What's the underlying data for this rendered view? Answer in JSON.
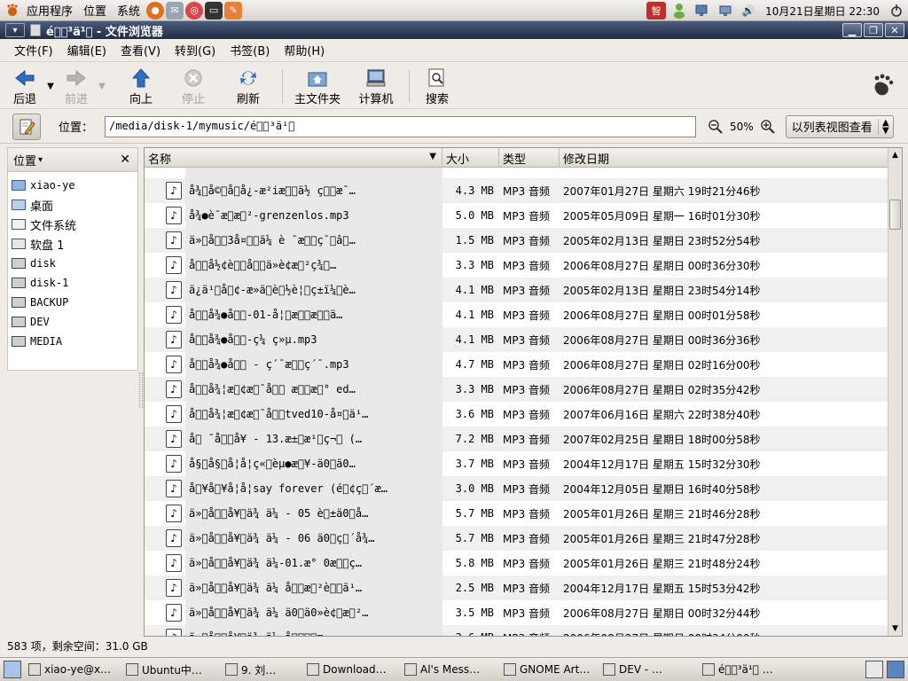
{
  "top_panel": {
    "menus": [
      "应用程序",
      "位置",
      "系统"
    ],
    "clock": "10月21日星期日 22:30"
  },
  "window": {
    "title": "é\u0000\u0000³ä¹\u0000 - 文件浏览器"
  },
  "menubar": [
    "文件(F)",
    "编辑(E)",
    "查看(V)",
    "转到(G)",
    "书签(B)",
    "帮助(H)"
  ],
  "toolbar": {
    "back": "后退",
    "forward": "前进",
    "up": "向上",
    "stop": "停止",
    "reload": "刷新",
    "home": "主文件夹",
    "computer": "计算机",
    "search": "搜索"
  },
  "location": {
    "label": "位置：",
    "path": "/media/disk-1/mymusic/é\u0000\u0000³ä¹\u0000",
    "zoom": "50%",
    "view_mode": "以列表视图查看"
  },
  "sidebar": {
    "header": "位置",
    "items": [
      {
        "label": "xiao-ye",
        "icon": "home-icon"
      },
      {
        "label": "桌面",
        "icon": "desktop-icon"
      },
      {
        "label": "文件系统",
        "icon": "filesystem-icon"
      },
      {
        "label": "软盘 1",
        "icon": "floppy-icon"
      },
      {
        "label": "disk",
        "icon": "drive-icon"
      },
      {
        "label": "disk-1",
        "icon": "drive-icon"
      },
      {
        "label": "BACKUP",
        "icon": "drive-icon"
      },
      {
        "label": "DEV",
        "icon": "drive-icon"
      },
      {
        "label": "MEDIA",
        "icon": "drive-icon"
      }
    ]
  },
  "columns": {
    "name": "名称",
    "size": "大小",
    "type": "类型",
    "date": "修改日期"
  },
  "files": [
    {
      "name": "å¾\u0000å©\u0000å\u0000å¿-æ²iæ\u0000\u0000ä½ ç\u0000\u0000æ¯…",
      "size": "4.3 MB",
      "type": "MP3 音频",
      "date": "2007年01月27日 星期六 19时21分46秒"
    },
    {
      "name": "å¾●è¯æ\u0000æ\u0000²-grenzenlos.mp3",
      "size": "5.0 MB",
      "type": "MP3 音频",
      "date": "2005年05月09日 星期一 16时01分30秒"
    },
    {
      "name": "ä»\u0000å\u0000\u00003å¤\u0000\u0000ä¼ è ¯æ\u0000\u0000ç¯\u0000â\u0000…",
      "size": "1.5 MB",
      "type": "MP3 音频",
      "date": "2005年02月13日 星期日 23时52分54秒"
    },
    {
      "name": "å\u0000\u0000å½¢è\u0000\u0000å\u0000\u0000ä»è¢æ\u0000²ç¾\u0000…",
      "size": "3.3 MB",
      "type": "MP3 音频",
      "date": "2006年08月27日 星期日 00时36分30秒"
    },
    {
      "name": "ä¿ä¹\u0000å\u0000¢-æ»ä\u0000è\u0000½è¦\u0000ç±ï¼\u0000è…",
      "size": "4.1 MB",
      "type": "MP3 音频",
      "date": "2005年02月13日 星期日 23时54分14秒"
    },
    {
      "name": "å\u0000\u0000å¾●å\u0000\u0000-01-å¦\u0000æ\u0000\u0000æ\u0000\u0000ä…",
      "size": "4.1 MB",
      "type": "MP3 音频",
      "date": "2006年08月27日 星期日 00时01分58秒"
    },
    {
      "name": "å\u0000\u0000å¾●å\u0000\u0000-ç¼ ç»µ.mp3",
      "size": "4.1 MB",
      "type": "MP3 音频",
      "date": "2006年08月27日 星期日 00时36分36秒"
    },
    {
      "name": "å\u0000\u0000å¾●å\u0000\u0000 - ç´¯æ\u0000\u0000ç´¯.mp3",
      "size": "4.7 MB",
      "type": "MP3 音频",
      "date": "2006年08月27日 星期日 02时16分00秒"
    },
    {
      "name": "å\u0000\u0000å¾¦æ\u0000¢æ\u0000¯å\u0000\u0000 æ\u0000\u0000æ\u0000° ed…",
      "size": "3.3 MB",
      "type": "MP3 音频",
      "date": "2006年08月27日 星期日 02时35分42秒"
    },
    {
      "name": "å\u0000\u0000å¾¦æ\u0000¢æ\u0000¯å\u0000\u0000tved10-å¤\u0000ä¹…",
      "size": "3.6 MB",
      "type": "MP3 音频",
      "date": "2007年06月16日 星期六 22时38分40秒"
    },
    {
      "name": "å\u0000 ¯å\u0000\u0000å¥ - 13.æ±\u0000æ¹\u0000ç¬\u0000 (…",
      "size": "7.2 MB",
      "type": "MP3 音频",
      "date": "2007年02月25日 星期日 18时00分58秒"
    },
    {
      "name": "å§\u0000å§\u0000å¦å¦ç«\u0000èµ●æ\u0000¥-ä0\u0000ä0…",
      "size": "3.7 MB",
      "type": "MP3 音频",
      "date": "2004年12月17日 星期五 15时32分30秒"
    },
    {
      "name": "å\u0000¥å\u0000¥å¦å¦say forever (é\u0000¢ç\u0000´æ…",
      "size": "3.0 MB",
      "type": "MP3 音频",
      "date": "2004年12月05日 星期日 16时40分58秒"
    },
    {
      "name": "ä»\u0000å\u0000\u0000å¥\u0000ä¾ ä¼ - 05 è\u0000±ä0\u0000å…",
      "size": "5.7 MB",
      "type": "MP3 音频",
      "date": "2005年01月26日 星期三 21时46分28秒"
    },
    {
      "name": "ä»\u0000å\u0000\u0000å¥\u0000ä¾ ä¼ - 06 ä0\u0000ç\u0000´å¾…",
      "size": "5.7 MB",
      "type": "MP3 音频",
      "date": "2005年01月26日 星期三 21时47分28秒"
    },
    {
      "name": "ä»\u0000å\u0000\u0000å¥\u0000ä¾ ä¼-01.æ° 0æ\u0000\u0000ç…",
      "size": "5.8 MB",
      "type": "MP3 音频",
      "date": "2005年01月26日 星期三 21时48分24秒"
    },
    {
      "name": "ä»\u0000å\u0000\u0000å¥\u0000ä¾ ä¼ å\u0000\u0000æ\u0000²è\u0000\u0000ä¹…",
      "size": "2.5 MB",
      "type": "MP3 音频",
      "date": "2004年12月17日 星期五 15时53分42秒"
    },
    {
      "name": "ä»\u0000å\u0000\u0000å¥\u0000ä¾ ä¼ ä0\u0000ä0»è¢\u0000æ\u0000²…",
      "size": "3.5 MB",
      "type": "MP3 音频",
      "date": "2006年08月27日 星期日 00时32分44秒"
    },
    {
      "name": "ä»\u0000å\u0000\u0000å¥\u0000ä¾ ä¼ å\u0000\u0000\u0000\u0000æ…",
      "size": "3.6 MB",
      "type": "MP3 音频",
      "date": "2006年08月27日 星期日 00时34分00秒"
    }
  ],
  "status": "583 项，剩余空间：31.0 GB",
  "taskbar": [
    {
      "label": "xiao-ye@x…",
      "icon": "terminal-icon"
    },
    {
      "label": "Ubuntu中…",
      "icon": "firefox-icon"
    },
    {
      "label": "9. 刘…",
      "icon": "music-icon"
    },
    {
      "label": "Download…",
      "icon": "folder-icon"
    },
    {
      "label": "Al's Mess…",
      "icon": "window-icon"
    },
    {
      "label": "GNOME Art…",
      "icon": "art-icon"
    },
    {
      "label": "DEV - …",
      "icon": "folder-icon"
    },
    {
      "label": "é\u0000\u0000³ä¹\u0000 …",
      "icon": "folder-icon"
    }
  ]
}
